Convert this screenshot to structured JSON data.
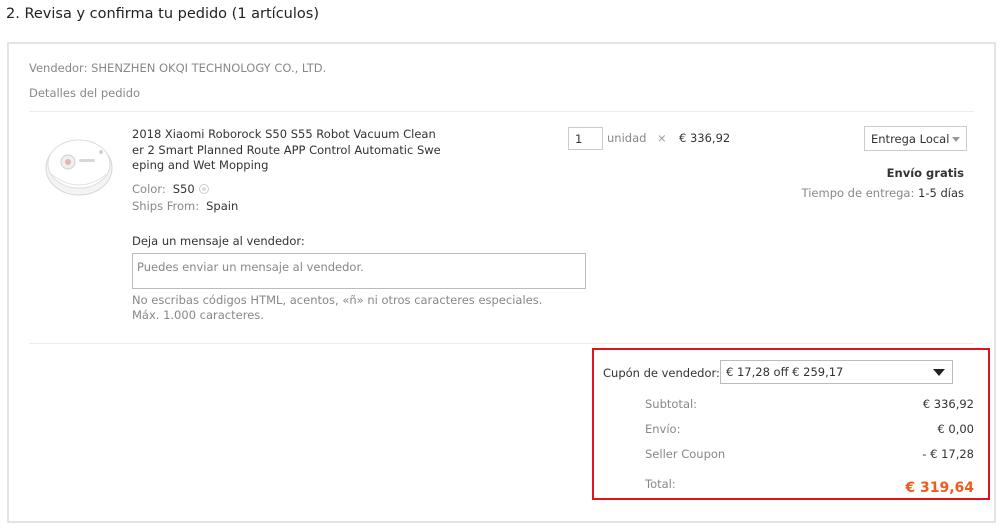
{
  "section": {
    "title": "2. Revisa y confirma tu pedido (1 artículos)"
  },
  "order": {
    "seller": "Vendedor: SHENZHEN OKQI TECHNOLOGY CO., LTD.",
    "details_label": "Detalles del pedido",
    "product": {
      "image_icon": "robot-vacuum-icon",
      "title": "2018 Xiaomi Roborock S50 S55 Robot Vacuum Cleaner 2 Smart Planned Route APP Control Automatic Sweeping and Wet Mopping",
      "color_label": "Color:",
      "color_value": "S50",
      "ships_from_label": "Ships From:",
      "ships_from_value": "Spain",
      "quantity": "1",
      "unit_label": "unidad",
      "times_sign": "×",
      "unit_price": "€ 336,92"
    },
    "shipping": {
      "method": "Entrega Local",
      "free_label": "Envío gratis",
      "delivery_label": "Tiempo de entrega:",
      "delivery_value": "1-5 días"
    },
    "message": {
      "label": "Deja un mensaje al vendedor:",
      "placeholder": "Puedes enviar un mensaje al vendedor.",
      "hint": "No escribas códigos HTML, acentos, «ñ» ni otros caracteres especiales. Máx. 1.000 caracteres."
    }
  },
  "summary": {
    "coupon_label": "Cupón de vendedor:",
    "coupon_selected": "€ 17,28 off € 259,17",
    "subtotal_label": "Subtotal:",
    "subtotal_value": "€ 336,92",
    "shipping_label": "Envío:",
    "shipping_value": "€ 0,00",
    "coupon_row_label": "Seller Coupon",
    "coupon_row_value": "- € 17,28",
    "total_label": "Total:",
    "total_value": "€ 319,64"
  },
  "colors": {
    "highlight_border": "#e0141e",
    "total_price": "#f2591d"
  }
}
